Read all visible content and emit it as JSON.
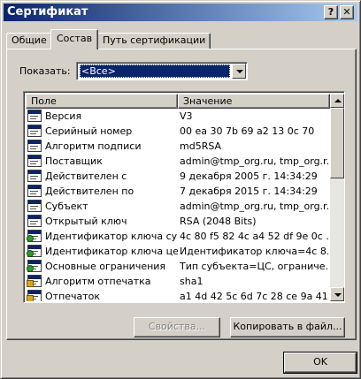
{
  "window": {
    "title": "Сертификат"
  },
  "title_buttons": {
    "help": "?",
    "close": "✕"
  },
  "tabs": [
    {
      "label": "Общие"
    },
    {
      "label": "Состав"
    },
    {
      "label": "Путь сертификации"
    }
  ],
  "show": {
    "label": "Показать:",
    "value": "<Все>"
  },
  "list": {
    "columns": [
      "Поле",
      "Значение"
    ],
    "rows": [
      {
        "field": "Версия",
        "value": "V3",
        "icon": "field-icon"
      },
      {
        "field": "Серийный номер",
        "value": "00 ea 30 7b 69 a2 13 0c 70",
        "icon": "field-icon"
      },
      {
        "field": "Алгоритм подписи",
        "value": "md5RSA",
        "icon": "field-icon"
      },
      {
        "field": "Поставщик",
        "value": "admin@tmp_org.ru, tmp_org.r...",
        "icon": "field-icon"
      },
      {
        "field": "Действителен с",
        "value": "9 декабря 2005 г. 14:34:29",
        "icon": "field-icon"
      },
      {
        "field": "Действителен по",
        "value": "7 декабря 2015 г. 14:34:29",
        "icon": "field-icon"
      },
      {
        "field": "Субъект",
        "value": "admin@tmp_org.ru, tmp_org.r...",
        "icon": "field-icon"
      },
      {
        "field": "Открытый ключ",
        "value": "RSA (2048 Bits)",
        "icon": "field-icon"
      },
      {
        "field": "Идентификатор ключа су...",
        "value": "4c 80 f5 82 4c a4 52 df 9e 0c ...",
        "icon": "extension-icon"
      },
      {
        "field": "Идентификатор ключа це...",
        "value": "Идентификатор ключа=4c 8...",
        "icon": "extension-icon"
      },
      {
        "field": "Основные ограничения",
        "value": "Тип субъекта=ЦС, ограниче...",
        "icon": "extension-icon"
      },
      {
        "field": "Алгоритм отпечатка",
        "value": "sha1",
        "icon": "property-icon"
      },
      {
        "field": "Отпечаток",
        "value": "a1 4d 42 5c 6d 7c 28 ce 9a 41 ...",
        "icon": "property-icon"
      }
    ]
  },
  "buttons": {
    "properties": "Свойства...",
    "copy_to_file": "Копировать в файл...",
    "ok": "OK"
  }
}
